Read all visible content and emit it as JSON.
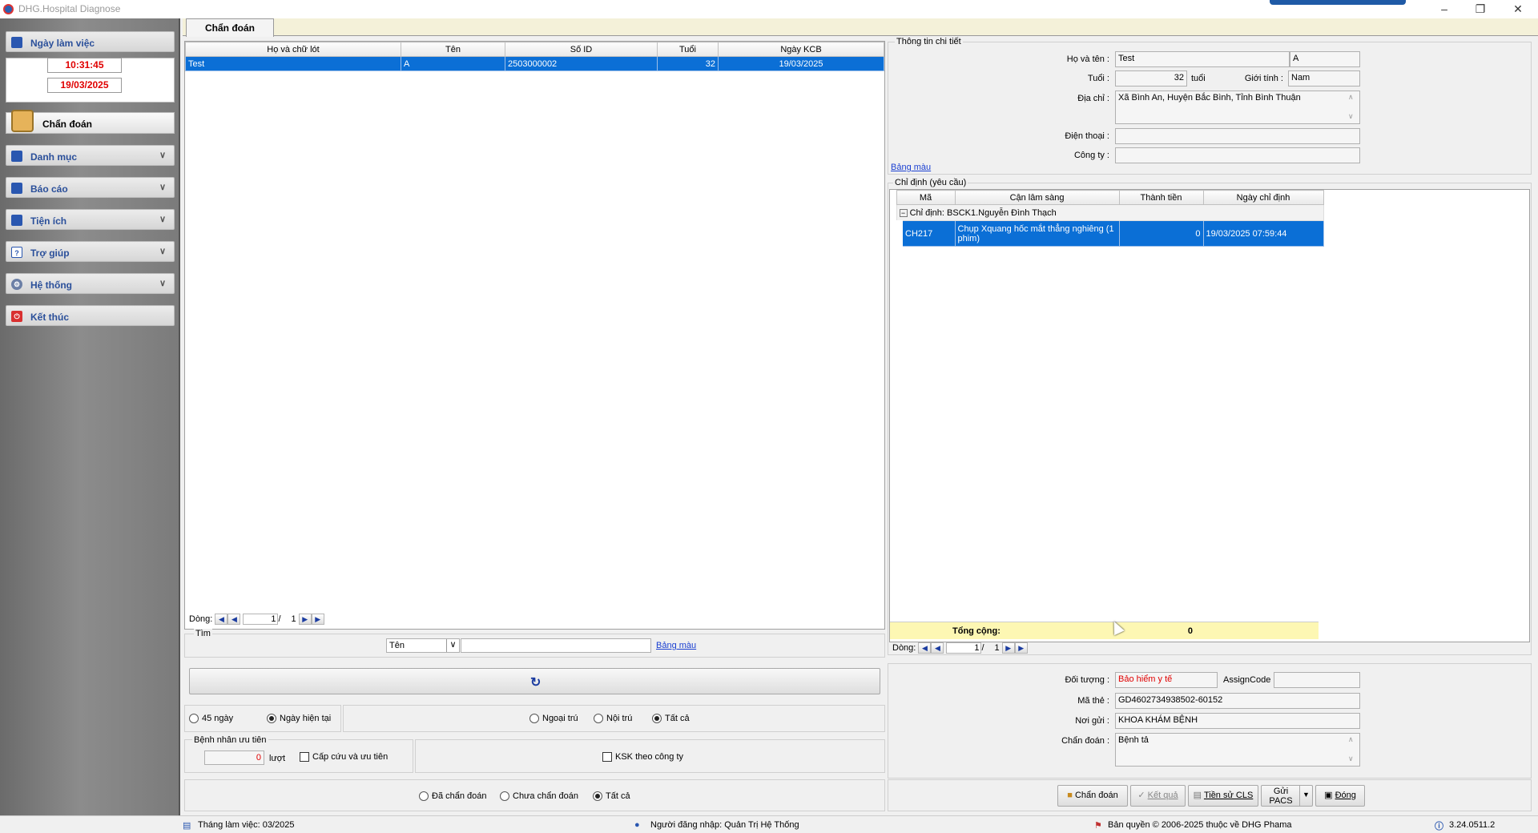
{
  "app": {
    "title": "DHG.Hospital Diagnose",
    "accent": "#1f5aa6"
  },
  "sidebar": {
    "workday_label": "Ngày làm việc",
    "time": "10:31:45",
    "date": "19/03/2025",
    "active_label": "Chẩn đoán",
    "items": [
      {
        "label": "Danh mục",
        "icon": "list-icon"
      },
      {
        "label": "Báo cáo",
        "icon": "report-icon"
      },
      {
        "label": "Tiện ích",
        "icon": "tools-icon"
      },
      {
        "label": "Trợ giúp",
        "icon": "help-icon"
      },
      {
        "label": "Hệ thống",
        "icon": "gear-icon"
      },
      {
        "label": "Kết thúc",
        "icon": "power-icon"
      }
    ]
  },
  "tab": {
    "label": "Chẩn đoán"
  },
  "patients": {
    "columns": [
      "Họ và chữ lót",
      "Tên",
      "Số ID",
      "Tuổi",
      "Ngày KCB"
    ],
    "rows": [
      {
        "ho": "Test",
        "ten": "A",
        "so_id": "2503000002",
        "tuoi": "32",
        "ngay": "19/03/2025"
      }
    ],
    "pager": {
      "label": "Dòng:",
      "page": "1",
      "sep": "/",
      "total": "1"
    }
  },
  "search": {
    "group_label": "Tìm",
    "select_value": "Tên",
    "input_value": "",
    "color_link": "Bảng màu"
  },
  "filters": {
    "days45": "45 ngày",
    "today": "Ngày hiện tại",
    "outpatient": "Ngoại trú",
    "inpatient": "Nội trú",
    "all": "Tất cả",
    "priority_group": "Bệnh nhân ưu tiên",
    "priority_count": "0",
    "priority_unit": "lượt",
    "emergency_label": "Cấp cứu và ưu tiên",
    "ksk_label": "KSK theo công ty",
    "diagnosed": "Đã chẩn đoán",
    "not_diagnosed": "Chưa chẩn đoán",
    "all2": "Tất cả"
  },
  "detail": {
    "group_label": "Thông tin chi tiết",
    "name_label": "Họ và tên :",
    "name_value": "Test",
    "first_name_value": "A",
    "age_label": "Tuổi :",
    "age_value": "32",
    "age_unit": "tuổi",
    "gender_label": "Giới tính :",
    "gender_value": "Nam",
    "address_label": "Địa chỉ :",
    "address_value": "Xã Bình An, Huyện Bắc Bình, Tỉnh Bình Thuận",
    "phone_label": "Điện thoại :",
    "phone_value": "",
    "company_label": "Công ty :",
    "company_value": "",
    "color_link": "Bảng màu"
  },
  "orders": {
    "group_label": "Chỉ định (yêu cầu)",
    "columns": [
      "Mã",
      "Cận lâm sàng",
      "Thành tiền",
      "Ngày chỉ định"
    ],
    "group_row": "Chỉ định:  BSCK1.Nguyễn Đình Thạch",
    "group_toggle": "−",
    "rows": [
      {
        "ma": "CH217",
        "cls": "Chụp Xquang hốc mắt thẳng nghiêng (1 phim)",
        "tien": "0",
        "ngay": "19/03/2025 07:59:44"
      }
    ],
    "total_label": "Tổng cộng:",
    "total_value": "0",
    "pager": {
      "label": "Dòng:",
      "page": "1",
      "sep": "/",
      "total": "1"
    }
  },
  "bottom_detail": {
    "object_label": "Đối tượng :",
    "object_value": "Bảo hiểm y tế",
    "assign_label": "AssignCode",
    "assign_value": "",
    "card_label": "Mã thẻ :",
    "card_value": "GD4602734938502-60152",
    "sender_label": "Nơi gửi :",
    "sender_value": "KHOA KHÁM BỆNH",
    "diagnosis_label": "Chẩn đoán :",
    "diagnosis_value": "Bệnh tả"
  },
  "actions": {
    "diagnose": "Chẩn đoán",
    "result": "Kết quả",
    "history": "Tiền sử CLS",
    "pacs": "Gửi PACS",
    "close": "Đóng"
  },
  "status": {
    "month": "Tháng làm việc: 03/2025",
    "user": "Người đăng nhập: Quản Trị Hệ Thống",
    "copyright": "Bản quyền © 2006-2025 thuộc về DHG Phama",
    "version": "3.24.0511.2"
  }
}
